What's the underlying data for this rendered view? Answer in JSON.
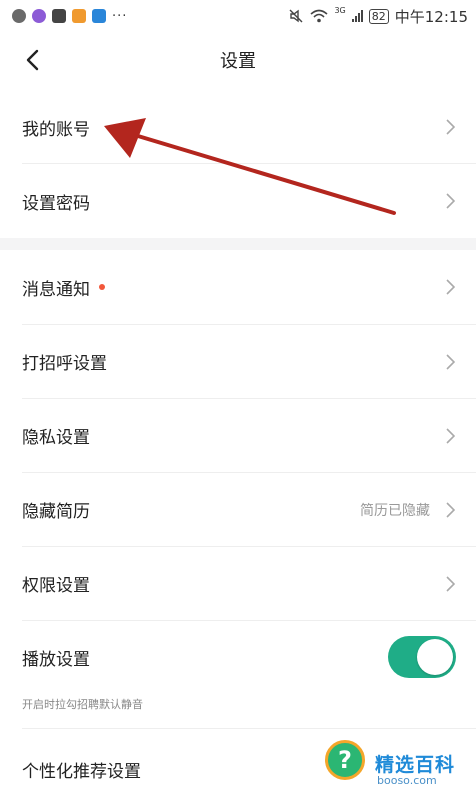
{
  "statusbar": {
    "overflow": "···",
    "network": "3G",
    "battery": "82",
    "time": "中午12:15"
  },
  "header": {
    "title": "设置"
  },
  "settings": {
    "account": {
      "label": "我的账号"
    },
    "password": {
      "label": "设置密码"
    },
    "notifications": {
      "label": "消息通知"
    },
    "greeting": {
      "label": "打招呼设置"
    },
    "privacy": {
      "label": "隐私设置"
    },
    "hide_resume": {
      "label": "隐藏简历",
      "value": "简历已隐藏"
    },
    "permissions": {
      "label": "权限设置"
    },
    "playback": {
      "label": "播放设置",
      "hint": "开启时拉勾招聘默认静音",
      "toggle_on": true
    },
    "personalized": {
      "label": "个性化推荐设置"
    }
  },
  "watermark": {
    "title": "精选百科",
    "url": "booso.com",
    "mark": "?"
  },
  "colors": {
    "accent": "#1fad87",
    "badge": "#f2573a",
    "annotation_arrow": "#b3261e"
  },
  "icons": {
    "back": "chevron-left-icon",
    "row_arrow": "chevron-right-icon"
  }
}
